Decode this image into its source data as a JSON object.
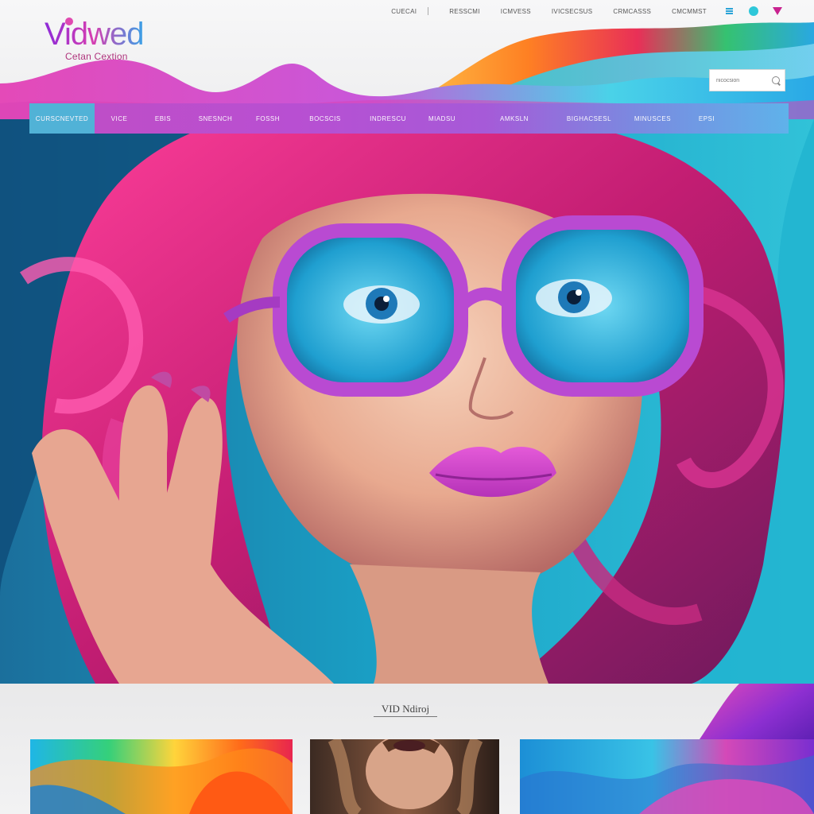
{
  "brand": {
    "logo_text": "Vidwed",
    "logo_sub": "Cetan Cextion"
  },
  "topnav": {
    "items": [
      "CUECAI",
      "RESSCMI",
      "ICMVESS",
      "IVICSECSUS",
      "CRMCASSS",
      "CMCMMST"
    ]
  },
  "search": {
    "placeholder": "nicocsion"
  },
  "mainnav": {
    "items": [
      "CURSCNEVTED",
      "VICE",
      "EBIS",
      "SNESNCH",
      "FOSSH",
      "BOCSCIS",
      "INDRESCU",
      "MIADSU",
      "AMKSLN",
      "BIGHACSESL",
      "MINUSCES",
      "EPSI"
    ]
  },
  "section": {
    "title": "VID Ndiroj"
  },
  "colors": {
    "accent_pink": "#d63fb1",
    "accent_purple": "#a65ad8",
    "accent_cyan": "#4cb8d8"
  }
}
